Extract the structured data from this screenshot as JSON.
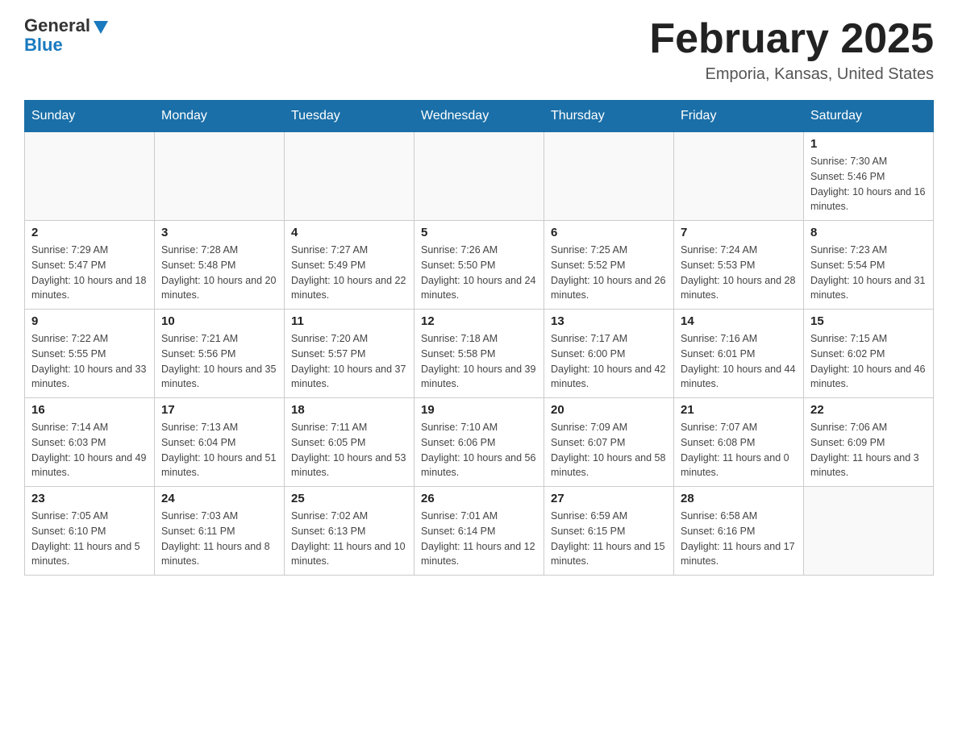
{
  "header": {
    "logo_general": "General",
    "logo_blue": "Blue",
    "month_title": "February 2025",
    "location": "Emporia, Kansas, United States"
  },
  "days_of_week": [
    "Sunday",
    "Monday",
    "Tuesday",
    "Wednesday",
    "Thursday",
    "Friday",
    "Saturday"
  ],
  "weeks": [
    [
      {
        "day": "",
        "sunrise": "",
        "sunset": "",
        "daylight": ""
      },
      {
        "day": "",
        "sunrise": "",
        "sunset": "",
        "daylight": ""
      },
      {
        "day": "",
        "sunrise": "",
        "sunset": "",
        "daylight": ""
      },
      {
        "day": "",
        "sunrise": "",
        "sunset": "",
        "daylight": ""
      },
      {
        "day": "",
        "sunrise": "",
        "sunset": "",
        "daylight": ""
      },
      {
        "day": "",
        "sunrise": "",
        "sunset": "",
        "daylight": ""
      },
      {
        "day": "1",
        "sunrise": "Sunrise: 7:30 AM",
        "sunset": "Sunset: 5:46 PM",
        "daylight": "Daylight: 10 hours and 16 minutes."
      }
    ],
    [
      {
        "day": "2",
        "sunrise": "Sunrise: 7:29 AM",
        "sunset": "Sunset: 5:47 PM",
        "daylight": "Daylight: 10 hours and 18 minutes."
      },
      {
        "day": "3",
        "sunrise": "Sunrise: 7:28 AM",
        "sunset": "Sunset: 5:48 PM",
        "daylight": "Daylight: 10 hours and 20 minutes."
      },
      {
        "day": "4",
        "sunrise": "Sunrise: 7:27 AM",
        "sunset": "Sunset: 5:49 PM",
        "daylight": "Daylight: 10 hours and 22 minutes."
      },
      {
        "day": "5",
        "sunrise": "Sunrise: 7:26 AM",
        "sunset": "Sunset: 5:50 PM",
        "daylight": "Daylight: 10 hours and 24 minutes."
      },
      {
        "day": "6",
        "sunrise": "Sunrise: 7:25 AM",
        "sunset": "Sunset: 5:52 PM",
        "daylight": "Daylight: 10 hours and 26 minutes."
      },
      {
        "day": "7",
        "sunrise": "Sunrise: 7:24 AM",
        "sunset": "Sunset: 5:53 PM",
        "daylight": "Daylight: 10 hours and 28 minutes."
      },
      {
        "day": "8",
        "sunrise": "Sunrise: 7:23 AM",
        "sunset": "Sunset: 5:54 PM",
        "daylight": "Daylight: 10 hours and 31 minutes."
      }
    ],
    [
      {
        "day": "9",
        "sunrise": "Sunrise: 7:22 AM",
        "sunset": "Sunset: 5:55 PM",
        "daylight": "Daylight: 10 hours and 33 minutes."
      },
      {
        "day": "10",
        "sunrise": "Sunrise: 7:21 AM",
        "sunset": "Sunset: 5:56 PM",
        "daylight": "Daylight: 10 hours and 35 minutes."
      },
      {
        "day": "11",
        "sunrise": "Sunrise: 7:20 AM",
        "sunset": "Sunset: 5:57 PM",
        "daylight": "Daylight: 10 hours and 37 minutes."
      },
      {
        "day": "12",
        "sunrise": "Sunrise: 7:18 AM",
        "sunset": "Sunset: 5:58 PM",
        "daylight": "Daylight: 10 hours and 39 minutes."
      },
      {
        "day": "13",
        "sunrise": "Sunrise: 7:17 AM",
        "sunset": "Sunset: 6:00 PM",
        "daylight": "Daylight: 10 hours and 42 minutes."
      },
      {
        "day": "14",
        "sunrise": "Sunrise: 7:16 AM",
        "sunset": "Sunset: 6:01 PM",
        "daylight": "Daylight: 10 hours and 44 minutes."
      },
      {
        "day": "15",
        "sunrise": "Sunrise: 7:15 AM",
        "sunset": "Sunset: 6:02 PM",
        "daylight": "Daylight: 10 hours and 46 minutes."
      }
    ],
    [
      {
        "day": "16",
        "sunrise": "Sunrise: 7:14 AM",
        "sunset": "Sunset: 6:03 PM",
        "daylight": "Daylight: 10 hours and 49 minutes."
      },
      {
        "day": "17",
        "sunrise": "Sunrise: 7:13 AM",
        "sunset": "Sunset: 6:04 PM",
        "daylight": "Daylight: 10 hours and 51 minutes."
      },
      {
        "day": "18",
        "sunrise": "Sunrise: 7:11 AM",
        "sunset": "Sunset: 6:05 PM",
        "daylight": "Daylight: 10 hours and 53 minutes."
      },
      {
        "day": "19",
        "sunrise": "Sunrise: 7:10 AM",
        "sunset": "Sunset: 6:06 PM",
        "daylight": "Daylight: 10 hours and 56 minutes."
      },
      {
        "day": "20",
        "sunrise": "Sunrise: 7:09 AM",
        "sunset": "Sunset: 6:07 PM",
        "daylight": "Daylight: 10 hours and 58 minutes."
      },
      {
        "day": "21",
        "sunrise": "Sunrise: 7:07 AM",
        "sunset": "Sunset: 6:08 PM",
        "daylight": "Daylight: 11 hours and 0 minutes."
      },
      {
        "day": "22",
        "sunrise": "Sunrise: 7:06 AM",
        "sunset": "Sunset: 6:09 PM",
        "daylight": "Daylight: 11 hours and 3 minutes."
      }
    ],
    [
      {
        "day": "23",
        "sunrise": "Sunrise: 7:05 AM",
        "sunset": "Sunset: 6:10 PM",
        "daylight": "Daylight: 11 hours and 5 minutes."
      },
      {
        "day": "24",
        "sunrise": "Sunrise: 7:03 AM",
        "sunset": "Sunset: 6:11 PM",
        "daylight": "Daylight: 11 hours and 8 minutes."
      },
      {
        "day": "25",
        "sunrise": "Sunrise: 7:02 AM",
        "sunset": "Sunset: 6:13 PM",
        "daylight": "Daylight: 11 hours and 10 minutes."
      },
      {
        "day": "26",
        "sunrise": "Sunrise: 7:01 AM",
        "sunset": "Sunset: 6:14 PM",
        "daylight": "Daylight: 11 hours and 12 minutes."
      },
      {
        "day": "27",
        "sunrise": "Sunrise: 6:59 AM",
        "sunset": "Sunset: 6:15 PM",
        "daylight": "Daylight: 11 hours and 15 minutes."
      },
      {
        "day": "28",
        "sunrise": "Sunrise: 6:58 AM",
        "sunset": "Sunset: 6:16 PM",
        "daylight": "Daylight: 11 hours and 17 minutes."
      },
      {
        "day": "",
        "sunrise": "",
        "sunset": "",
        "daylight": ""
      }
    ]
  ]
}
